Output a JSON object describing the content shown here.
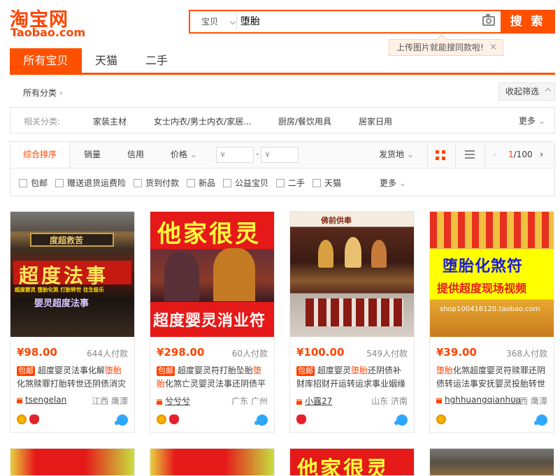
{
  "logo": {
    "cn": "淘宝网",
    "en": "Taobao.com"
  },
  "search": {
    "type": "宝贝",
    "query": "堕胎",
    "button": "搜 索",
    "tip": "上传图片就能搜同款啦!",
    "tip_close": "×"
  },
  "tabs": [
    "所有宝贝",
    "天猫",
    "二手"
  ],
  "nav": {
    "all_categories": "所有分类",
    "collapse": "收起筛选"
  },
  "related": {
    "label": "相关分类:",
    "items": [
      "家装主材",
      "女士内衣/男士内衣/家居...",
      "厨房/餐饮用具",
      "居家日用"
    ],
    "more": "更多"
  },
  "sort": {
    "items": [
      "综合排序",
      "销量",
      "信用",
      "价格"
    ],
    "price_from": "¥",
    "price_to": "¥",
    "price_sep": "-",
    "ship_from": "发货地",
    "page_current": "1",
    "page_total": "/100",
    "prev": "‹",
    "next": "›"
  },
  "filters": {
    "items": [
      "包邮",
      "赠送退货运费险",
      "货到付款",
      "新品",
      "公益宝贝",
      "二手",
      "天猫"
    ],
    "more": "更多"
  },
  "colors": {
    "accent": "#ff5000",
    "price": "#ff4400"
  },
  "products": [
    {
      "price": "¥98.00",
      "sold": "644人付款",
      "tag": "包邮",
      "title_pre": "超度婴灵法事化解",
      "title_hl": "堕胎",
      "title_post": "化煞赎罪打胎转世还阴债消灾",
      "shop": "tsengelan",
      "loc": "江西 鹰潭",
      "badges": [
        "gold",
        "red"
      ],
      "img_text": {
        "top": "度超救苦",
        "main": "超度法事",
        "sub": "超度婴灵 堕胎化煞 打胎转世 往生极乐",
        "lower": "婴灵超度法事"
      }
    },
    {
      "price": "¥298.00",
      "sold": "60人付款",
      "tag": "包邮",
      "title_pre": "超度婴灵符打胎坠胎",
      "title_hl": "堕胎",
      "title_post": "化煞亡灵婴灵法事还阴债平",
      "shop": "兮兮兮",
      "loc": "广东 广州",
      "badges": [
        "gold",
        "red"
      ],
      "img_text": {
        "top": "他家很灵",
        "bottom": "超度婴灵消业符"
      }
    },
    {
      "price": "¥100.00",
      "sold": "549人付款",
      "tag": "包邮",
      "title_pre": "超度婴灵",
      "title_hl": "堕胎",
      "title_post": "还阴债补财库招财开运转运求事业姻缘",
      "shop": "小露27",
      "loc": "山东 济南",
      "badges": [
        "red"
      ],
      "img_text": {
        "top": "佛前供奉"
      }
    },
    {
      "price": "¥39.00",
      "sold": "368人付款",
      "tag": "",
      "title_pre": "",
      "title_hl": "堕胎",
      "title_post": "化煞超度婴灵符赎罪还阴债转运法事安抚婴灵投胎转世",
      "shop": "hghhuangqianhua",
      "loc": "江西 鹰潭",
      "badges": [
        "gold"
      ],
      "img_text": {
        "line1": "堕胎化煞符",
        "line2": "提供超度现场视频",
        "wm": "shop100416120.taobao.com"
      }
    }
  ],
  "row2": [
    {
      "text": ""
    },
    {
      "text": ""
    },
    {
      "text": "他家很灵"
    },
    {
      "text": ""
    }
  ]
}
